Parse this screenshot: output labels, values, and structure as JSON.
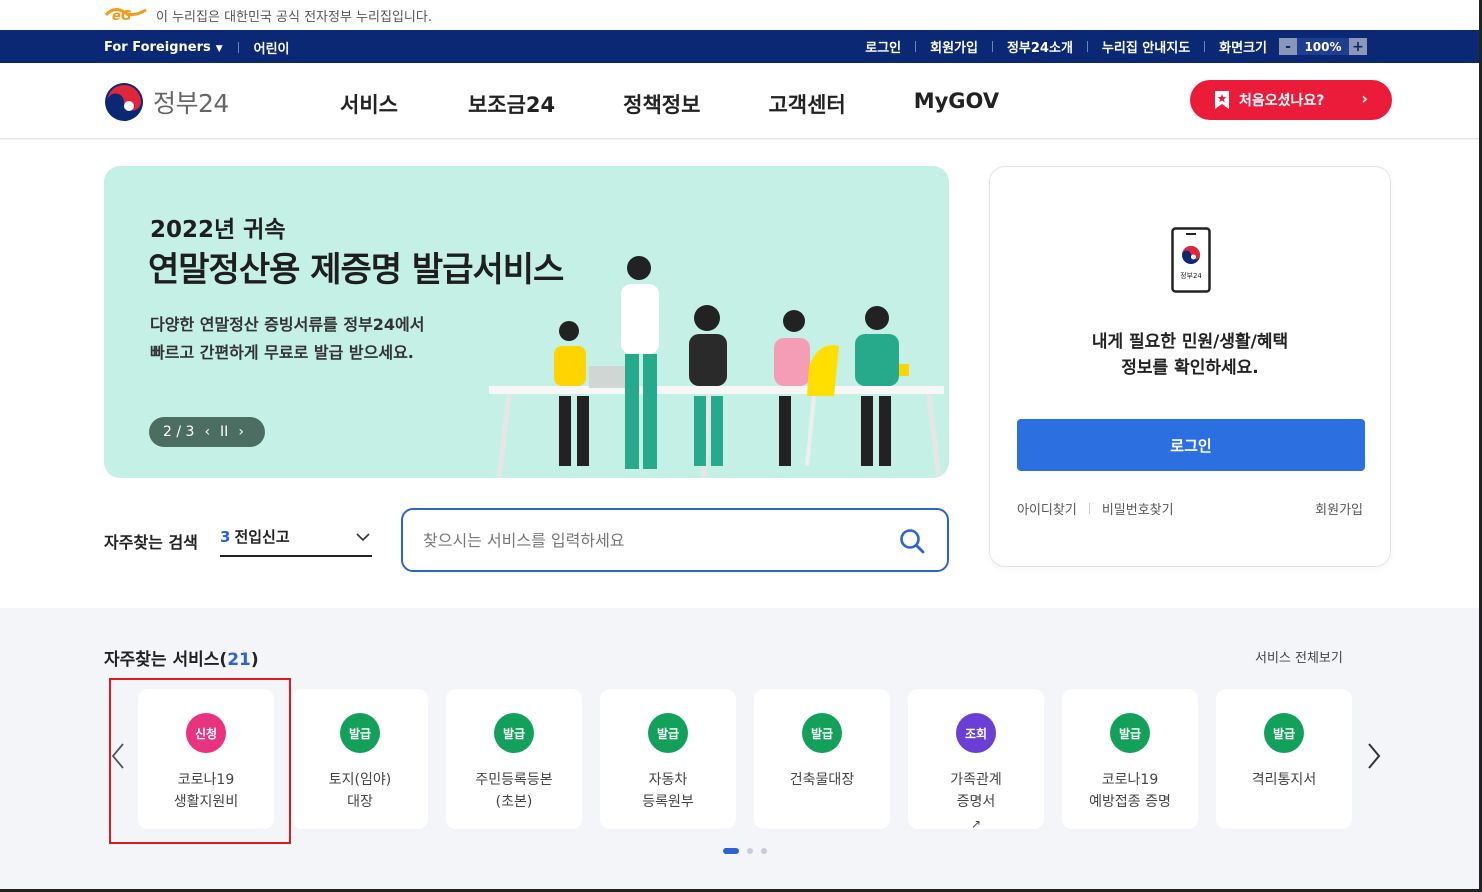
{
  "notice": {
    "text": "이 누리집은 대한민국 공식 전자정부 누리집입니다."
  },
  "util": {
    "foreigners": "For Foreigners",
    "kids": "어린이",
    "login": "로그인",
    "join": "회원가입",
    "about": "정부24소개",
    "sitemap": "누리집 안내지도",
    "zoom_label": "화면크기",
    "zoom_minus": "-",
    "zoom_value": "100%",
    "zoom_plus": "+"
  },
  "header": {
    "logo_text": "정부24",
    "nav": [
      "서비스",
      "보조금24",
      "정책정보",
      "고객센터",
      "MyGOV"
    ],
    "cta": "처음오셨나요?"
  },
  "banner": {
    "subtitle": "2022년 귀속",
    "title": "연말정산용 제증명 발급서비스",
    "desc_line1": "다양한 연말정산 증빙서류를 정부24에서",
    "desc_line2": "빠르고 간편하게 무료로 발급 받으세요.",
    "page": "2 / 3"
  },
  "search": {
    "freq_label": "자주찾는 검색",
    "freq_rank": "3",
    "freq_value": "전입신고",
    "placeholder": "찾으시는 서비스를 입력하세요"
  },
  "login_card": {
    "phone_label": "정부24",
    "msg_line1": "내게 필요한 민원/생활/혜택",
    "msg_line2": "정보를 확인하세요.",
    "button": "로그인",
    "find_id": "아이디찾기",
    "find_pw": "비밀번호찾기",
    "join": "회원가입"
  },
  "services": {
    "title": "자주찾는 서비스",
    "count_open": "(",
    "count": "21",
    "count_close": ")",
    "view_all": "서비스 전체보기",
    "items": [
      {
        "badge": "신청",
        "color": "#e8337e",
        "line1": "코로나19",
        "line2": "생활지원비"
      },
      {
        "badge": "발급",
        "color": "#13a05a",
        "line1": "토지(임야)",
        "line2": "대장"
      },
      {
        "badge": "발급",
        "color": "#13a05a",
        "line1": "주민등록등본",
        "line2": "(초본)"
      },
      {
        "badge": "발급",
        "color": "#13a05a",
        "line1": "자동차",
        "line2": "등록원부"
      },
      {
        "badge": "발급",
        "color": "#13a05a",
        "line1": "건축물대장",
        "line2": ""
      },
      {
        "badge": "조회",
        "color": "#6a3fd6",
        "line1": "가족관계",
        "line2": "증명서"
      },
      {
        "badge": "발급",
        "color": "#13a05a",
        "line1": "코로나19",
        "line2": "예방접종 증명"
      },
      {
        "badge": "발급",
        "color": "#13a05a",
        "line1": "격리통지서",
        "line2": ""
      }
    ]
  },
  "colors": {
    "navy": "#0a2874",
    "accent_blue": "#2c63d3",
    "cta_red": "#ea1c3a",
    "banner_mint": "#c5f0e6"
  }
}
